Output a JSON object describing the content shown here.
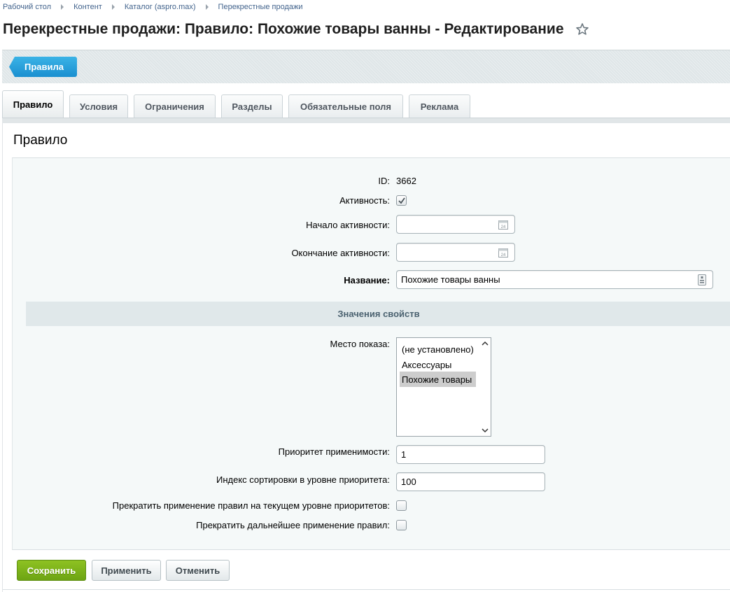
{
  "breadcrumbs": [
    "Рабочий стол",
    "Контент",
    "Каталог (aspro.max)",
    "Перекрестные продажи"
  ],
  "page_title": "Перекрестные продажи: Правило: Похожие товары ванны - Редактирование",
  "toolbar": {
    "back_label": "Правила"
  },
  "tabs": [
    {
      "label": "Правило",
      "active": true
    },
    {
      "label": "Условия",
      "active": false
    },
    {
      "label": "Ограничения",
      "active": false
    },
    {
      "label": "Разделы",
      "active": false
    },
    {
      "label": "Обязательные поля",
      "active": false
    },
    {
      "label": "Реклама",
      "active": false
    }
  ],
  "section_title": "Правило",
  "form": {
    "id_label": "ID:",
    "id_value": "3662",
    "active_label": "Активность:",
    "active_checked": true,
    "start_label": "Начало активности:",
    "start_value": "",
    "end_label": "Окончание активности:",
    "end_value": "",
    "name_label": "Название:",
    "name_value": "Похожие товары ванны",
    "group_header": "Значения свойств",
    "place_label": "Место показа:",
    "place_options": [
      "(не установлено)",
      "Аксессуары",
      "Похожие товары"
    ],
    "place_selected": "Похожие товары",
    "priority_label": "Приоритет применимости:",
    "priority_value": "1",
    "sort_label": "Индекс сортировки в уровне приоритета:",
    "sort_value": "100",
    "stop_level_label": "Прекратить применение правил на текущем уровне приоритетов:",
    "stop_level_checked": false,
    "stop_all_label": "Прекратить дальнейшее применение правил:",
    "stop_all_checked": false
  },
  "buttons": {
    "save": "Сохранить",
    "apply": "Применить",
    "cancel": "Отменить"
  },
  "colors": {
    "save_button": "#7cb518",
    "back_button": "#2aa3df",
    "group_header_bg": "#e0e8ea"
  }
}
